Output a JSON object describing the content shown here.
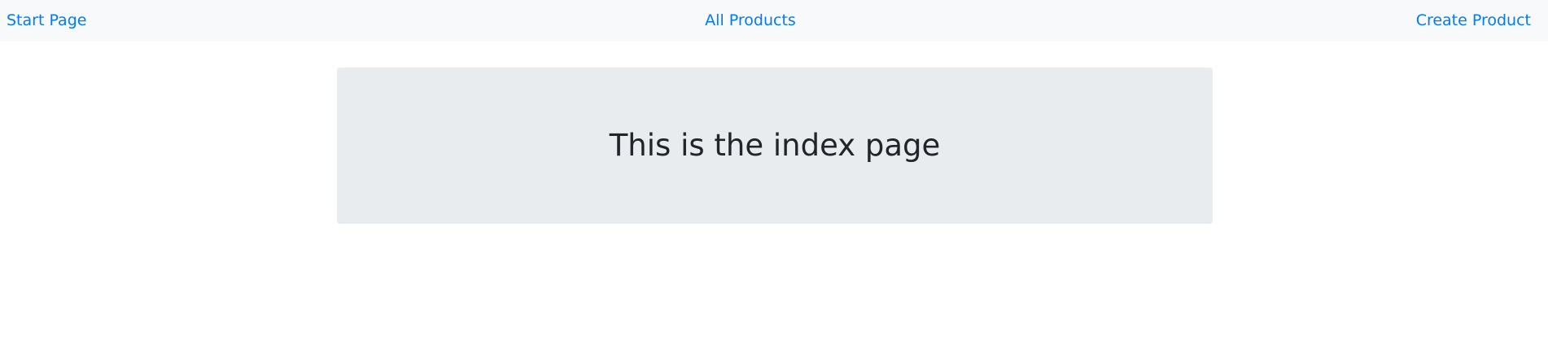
{
  "navbar": {
    "links": [
      {
        "label": "Start Page"
      },
      {
        "label": "All Products"
      },
      {
        "label": "Create Product"
      }
    ]
  },
  "main": {
    "title": "This is the index page"
  },
  "colors": {
    "link": "#007bff",
    "navbar_bg": "#f8f9fa",
    "jumbotron_bg": "#e9ecef",
    "text": "#212529"
  }
}
